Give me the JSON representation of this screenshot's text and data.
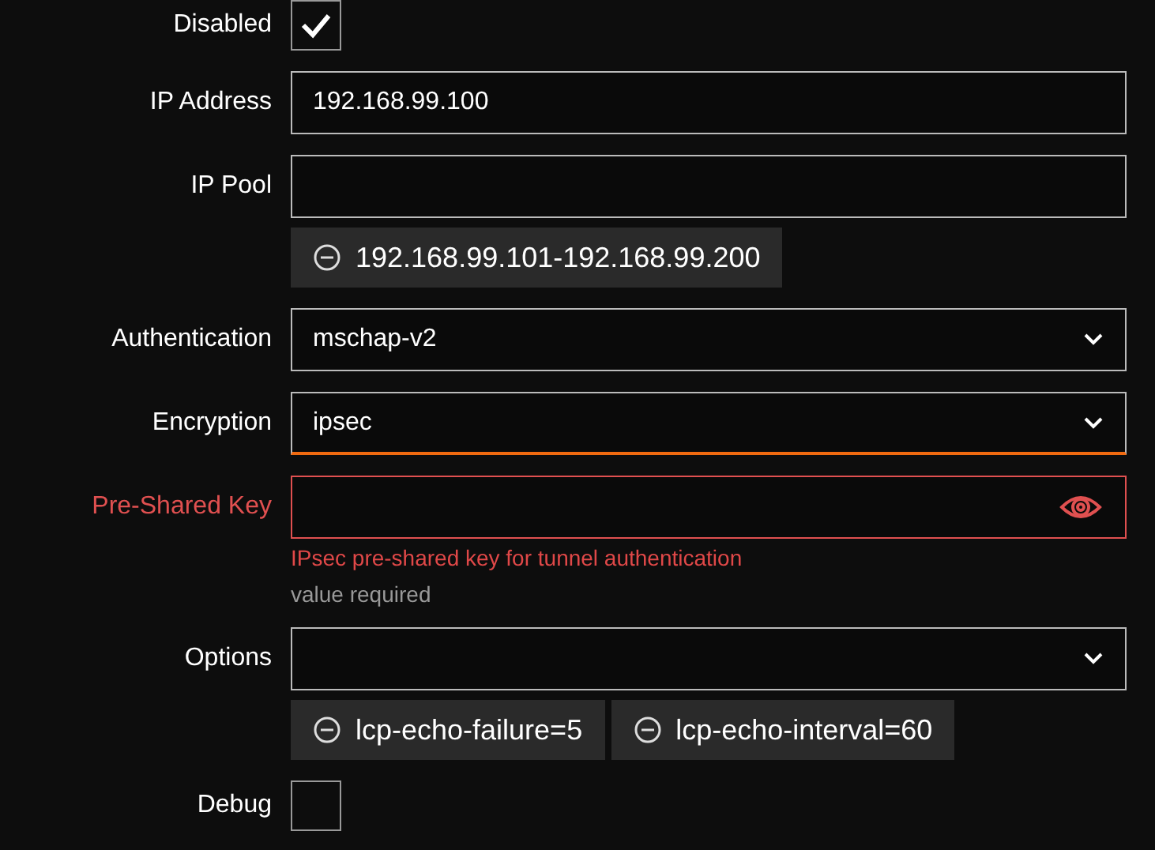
{
  "fields": [
    {
      "kind": "checkbox",
      "label": "Disabled",
      "checked": true
    },
    {
      "kind": "text",
      "label": "IP Address",
      "value": "192.168.99.100"
    },
    {
      "kind": "text",
      "label": "IP Pool",
      "chips": [
        "192.168.99.101-192.168.99.200"
      ]
    },
    {
      "kind": "select",
      "label": "Authentication",
      "value": "mschap-v2"
    },
    {
      "kind": "select",
      "label": "Encryption",
      "value": "ipsec",
      "focused": true
    },
    {
      "kind": "password",
      "label": "Pre-Shared Key",
      "error": true,
      "help": "IPsec pre-shared key for tunnel authentication",
      "message": "value required"
    },
    {
      "kind": "select",
      "label": "Options",
      "chips": [
        "lcp-echo-failure=5",
        "lcp-echo-interval=60"
      ]
    },
    {
      "kind": "checkbox",
      "label": "Debug",
      "checked": false
    }
  ]
}
